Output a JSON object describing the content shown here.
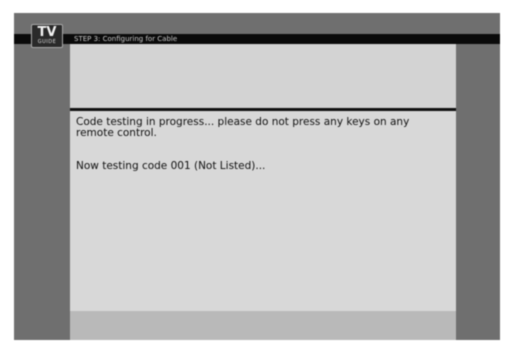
{
  "header": {
    "logo_text": "TV",
    "logo_subtext": "GUIDE",
    "step_title": "STEP 3: Configuring for Cable"
  },
  "body": {
    "message": "Code testing in progress... please do not press any keys on any remote control.",
    "status": "Now testing code 001 (Not Listed)..."
  }
}
